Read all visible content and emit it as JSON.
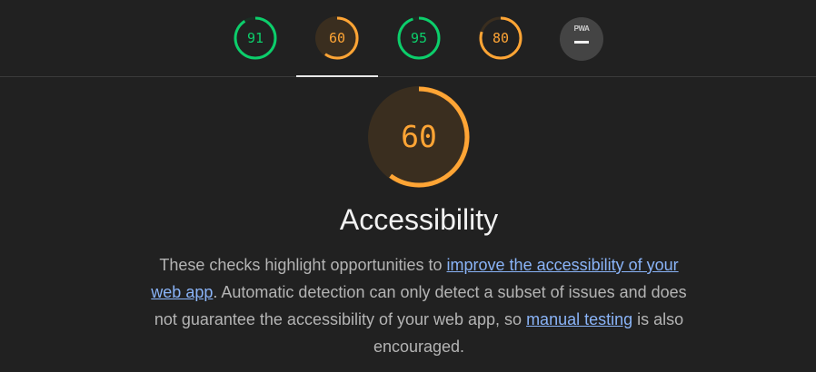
{
  "colors": {
    "background": "#212121",
    "pass": "#0cce6b",
    "average": "#ffa535",
    "link": "#8ab4f8"
  },
  "gauges": [
    {
      "score": "91",
      "status": "pass",
      "value": 0.91
    },
    {
      "score": "60",
      "status": "average",
      "value": 0.6,
      "active": true
    },
    {
      "score": "95",
      "status": "pass",
      "value": 0.95
    },
    {
      "score": "80",
      "status": "average",
      "value": 0.8
    }
  ],
  "pwa": {
    "label": "PWA",
    "icon": "pwa-badge-icon"
  },
  "category": {
    "score": "60",
    "value": 0.6,
    "title": "Accessibility",
    "description": {
      "part1": "These checks highlight opportunities to ",
      "link1": "improve the accessibility of your web app",
      "part2": ". Automatic detection can only detect a subset of issues and does not guarantee the accessibility of your web app, so ",
      "link2": "manual testing",
      "part3": " is also encouraged."
    }
  }
}
